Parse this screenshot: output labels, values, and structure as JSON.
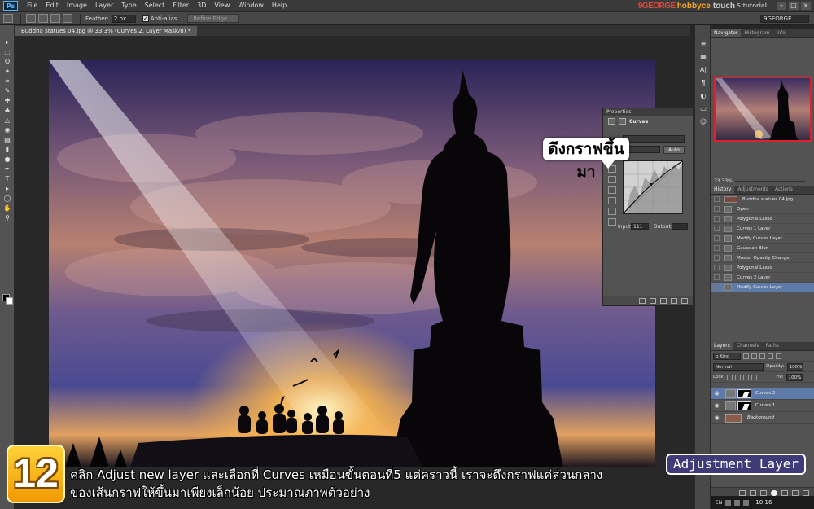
{
  "app": {
    "logo": "Ps",
    "menu": [
      "File",
      "Edit",
      "Image",
      "Layer",
      "Type",
      "Select",
      "Filter",
      "3D",
      "View",
      "Window",
      "Help"
    ],
    "brand": {
      "part1": "9GEORGE",
      "part2": "hobbyce",
      "part3": "touch",
      "part4": "S tutorial"
    },
    "window_controls": [
      "–",
      "□",
      "×"
    ]
  },
  "options": {
    "feather_label": "Feather:",
    "feather_value": "2 px",
    "antialias_label": "Anti-alias",
    "antialias_checked": "✓",
    "refine_edge": "Refine Edge...",
    "workspace": "9GEORGE"
  },
  "document": {
    "tab_title": "Buddha statues 04.jpg @ 33.3% (Curves 2, Layer Mask/8) *"
  },
  "toolbar": {
    "tools": [
      "▸",
      "⬚",
      "ʘ",
      "✦",
      "⌗",
      "✎",
      "✚",
      "♣",
      "◬",
      "◉",
      "▤",
      "▮",
      "●",
      "✒",
      "T",
      "▸",
      "◯",
      "✋",
      "⚲"
    ]
  },
  "properties": {
    "header": "Properties",
    "title": "Curves",
    "auto_button": "Auto",
    "input_label": "Input:",
    "input_value": "111",
    "output_label": "Output:"
  },
  "callouts": {
    "curve": "ดึงกราฟขึ้นมา",
    "adjustment": "Adjustment Layer"
  },
  "right_strip": {
    "icons": [
      "≡",
      "▦",
      "A|",
      "¶",
      "◐",
      "▭",
      "☺"
    ]
  },
  "navigator": {
    "tabs": [
      "Navigator",
      "Histogram",
      "Info"
    ],
    "zoom": "33.33%"
  },
  "history": {
    "tabs": [
      "History",
      "Adjustments",
      "Actions"
    ],
    "items": [
      {
        "label": "Buddha statues 04.jpg"
      },
      {
        "label": "Open"
      },
      {
        "label": "Polygonal Lasso"
      },
      {
        "label": "Curves 1 Layer"
      },
      {
        "label": "Modify Curves Layer"
      },
      {
        "label": "Gaussian Blur"
      },
      {
        "label": "Master Opacity Change"
      },
      {
        "label": "Polygonal Lasso"
      },
      {
        "label": "Curves 2 Layer"
      },
      {
        "label": "Modify Curves Layer"
      }
    ]
  },
  "layers": {
    "tabs": [
      "Layers",
      "Channels",
      "Paths"
    ],
    "kind": "ρ Kind",
    "blend": "Normal",
    "opacity_label": "Opacity:",
    "opacity": "100%",
    "lock_label": "Lock:",
    "fill_label": "Fill:",
    "fill": "100%",
    "items": [
      {
        "name": "Curves 2",
        "selected": true
      },
      {
        "name": "Curves 1",
        "selected": false
      },
      {
        "name": "Background",
        "selected": false
      }
    ]
  },
  "taskbar": {
    "lang": "EN",
    "time": "10:16"
  },
  "tutorial": {
    "step": "12",
    "line1": "คลิก Adjust new layer และเลือกที่ Curves เหมือนขั้นตอนที่5 แต่คราวนี้ เราจะดึงกราฟแค่ส่วนกลาง",
    "line2": "ของเส้นกราฟให้ขึ้นมาเพียงเล็กน้อย ประมาณภาพตัวอย่าง"
  },
  "colors": {
    "selection_blue": "#5e7aa8",
    "badge_gold": "#f5b21a",
    "callout_purple": "#3f3a78",
    "nav_red": "#e0202a"
  }
}
